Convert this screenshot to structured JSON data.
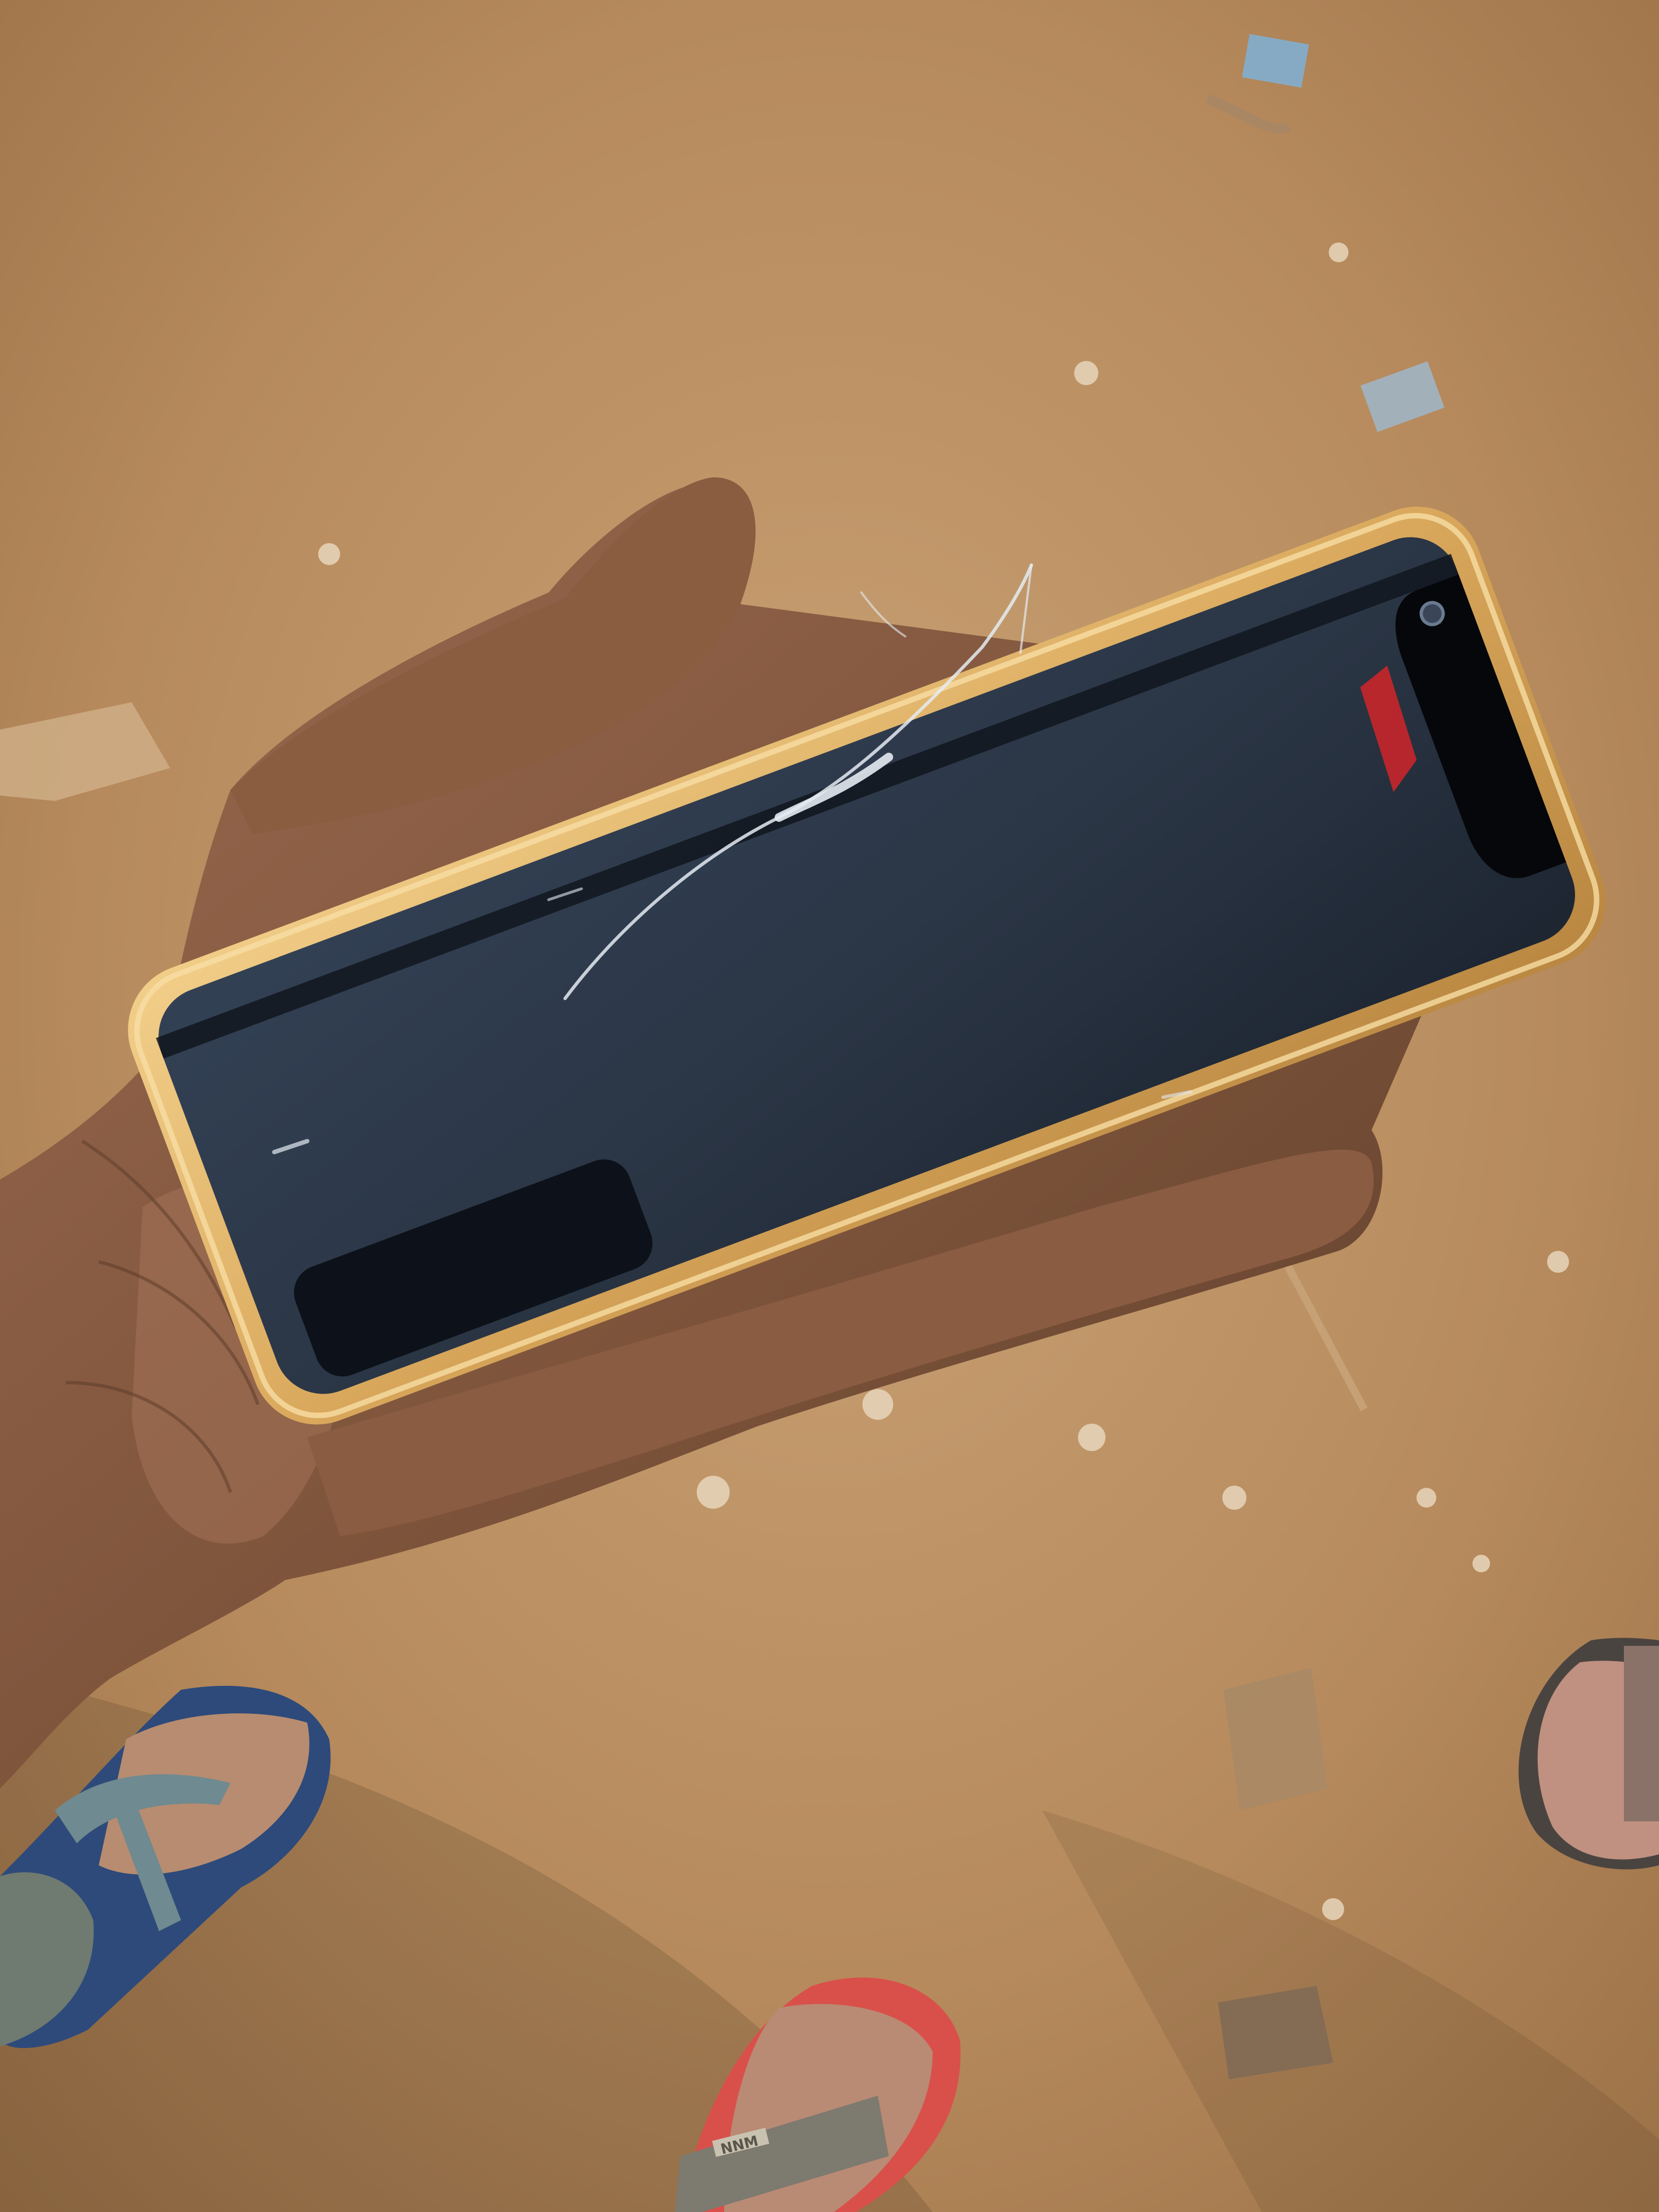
{
  "scene": {
    "description_tag": "photo",
    "colors": {
      "ground": "#b58a5c",
      "ground_light": "#c9a274",
      "ground_dark": "#8c6640",
      "skin": "#7a5038",
      "skin_light": "#a47358",
      "phone_frame": "#d9a85c",
      "phone_frame_highlight": "#f4d394",
      "screen": "#2c3848",
      "screen_dark": "#141b26",
      "crack": "#dfe6ee",
      "sandal_blue_strap": "#6f8a90",
      "sandal_blue_sole": "#2d4a7a",
      "sandal_red_sole": "#d9504a",
      "sandal_red_strap": "#7d7a6f",
      "reflection_red": "#c8262a"
    },
    "objects": [
      {
        "name": "ground-dirt",
        "kind": "background"
      },
      {
        "name": "hand",
        "kind": "subject"
      },
      {
        "name": "phone-gold-case",
        "kind": "subject"
      },
      {
        "name": "phone-screen-cracked",
        "kind": "subject"
      },
      {
        "name": "front-camera-notch",
        "kind": "detail"
      },
      {
        "name": "foot-left-blue-sandal",
        "kind": "background-object"
      },
      {
        "name": "foot-bottom-red-sandal",
        "kind": "background-object"
      },
      {
        "name": "foot-right-sandal",
        "kind": "background-object"
      }
    ]
  },
  "sandal_brand_text": "NNM"
}
